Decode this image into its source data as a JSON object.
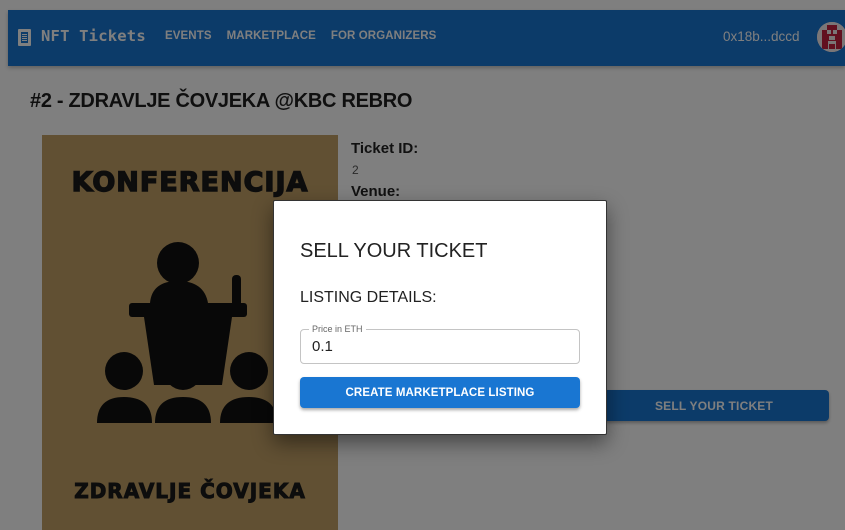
{
  "appbar": {
    "brand": "NFT Tickets",
    "nav": [
      "EVENTS",
      "MARKETPLACE",
      "FOR ORGANIZERS"
    ],
    "wallet_address": "0x18b...dccd"
  },
  "page": {
    "title": "#2 - ZDRAVLJE ČOVJEKA @KBC REBRO",
    "poster": {
      "top_text": "KONFERENCIJA",
      "bottom_text": "ZDRAVLJE ČOVJEKA",
      "illustration": "conference-speaker-icon"
    },
    "details": [
      {
        "label": "Ticket ID:",
        "value": "2"
      },
      {
        "label": "Venue:",
        "value": ""
      }
    ],
    "sell_button_label": "SELL YOUR TICKET"
  },
  "dialog": {
    "title": "SELL YOUR TICKET",
    "subtitle": "LISTING DETAILS:",
    "price_field": {
      "label": "Price in ETH",
      "value": "0.1"
    },
    "submit_label": "CREATE MARKETPLACE LISTING"
  },
  "colors": {
    "primary": "#1976d2",
    "poster_background": "#c3a066",
    "backdrop": "rgba(0,0,0,0.5)"
  }
}
